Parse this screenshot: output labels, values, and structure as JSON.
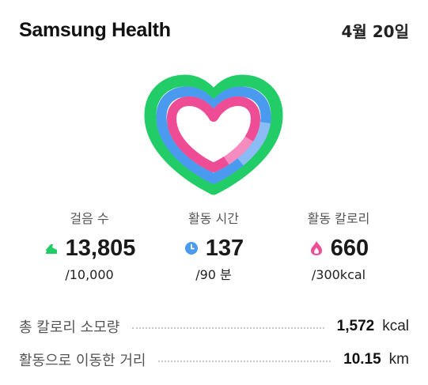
{
  "header": {
    "app_title": "Samsung Health",
    "date": "4월 20일"
  },
  "rings": {
    "outer_color": "#22cc66",
    "middle_color": "#4a9af0",
    "inner_color": "#ee4d96",
    "outer_progress": 1.0,
    "middle_progress": 1.0,
    "inner_progress": 1.0
  },
  "stats": {
    "steps": {
      "label": "걸음 수",
      "value": "13,805",
      "goal": "/10,000",
      "icon": "shoe-icon",
      "color": "#22cc66"
    },
    "active_time": {
      "label": "활동 시간",
      "value": "137",
      "goal": "/90 분",
      "icon": "clock-icon",
      "color": "#4a9af0"
    },
    "active_calories": {
      "label": "활동 칼로리",
      "value": "660",
      "goal": "/300kcal",
      "icon": "flame-icon",
      "color": "#ee4d96"
    }
  },
  "summary": {
    "total_calories": {
      "label": "총 칼로리 소모량",
      "value": "1,572",
      "unit": "kcal"
    },
    "distance": {
      "label": "활동으로 이동한 거리",
      "value": "10.15",
      "unit": "km"
    }
  }
}
